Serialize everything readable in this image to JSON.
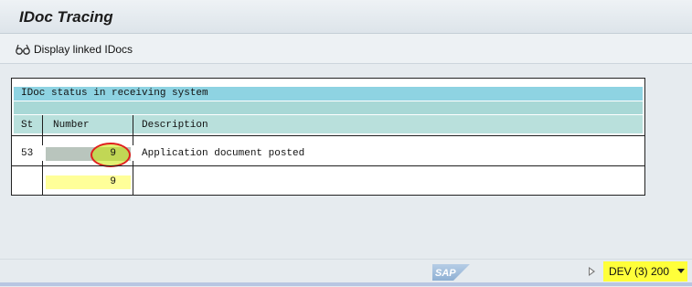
{
  "window": {
    "title": "IDoc Tracing"
  },
  "toolbar": {
    "display_linked_label": "Display linked IDocs",
    "display_linked_icon": "glasses-icon"
  },
  "table": {
    "caption": "IDoc status in receiving system",
    "columns": [
      "St",
      "Number",
      "Description"
    ],
    "rows": [
      {
        "status": "53",
        "number": "9",
        "description": "Application document posted"
      }
    ],
    "total": {
      "number": "9"
    }
  },
  "status_bar": {
    "logo": "SAP",
    "system": "DEV (3) 200",
    "expand_icon": "play-triangle-icon",
    "dropdown_icon": "caret-down-icon"
  },
  "colors": {
    "highlight_yellow": "#ffff3a",
    "total_cell": "#ffff99",
    "annotation_circle": "#e0201e",
    "table_caption": "#8ed3e2"
  }
}
